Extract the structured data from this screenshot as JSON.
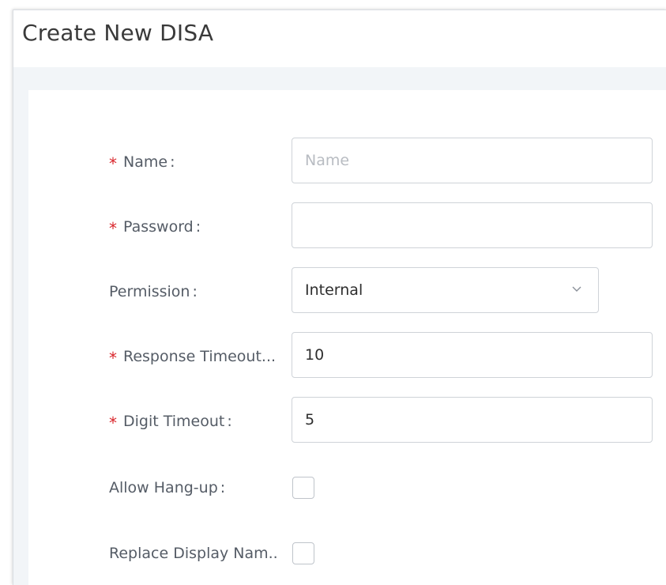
{
  "dialog": {
    "title": "Create New DISA"
  },
  "form": {
    "required_mark": "*",
    "name": {
      "label": "Name",
      "colon": ":",
      "placeholder": "Name",
      "value": ""
    },
    "password": {
      "label": "Password",
      "colon": ":",
      "value": ""
    },
    "permission": {
      "label": "Permission",
      "colon": ":",
      "selected": "Internal"
    },
    "response_timeout": {
      "label": "Response Timeout...",
      "value": "10"
    },
    "digit_timeout": {
      "label": "Digit Timeout",
      "colon": ":",
      "value": "5"
    },
    "allow_hangup": {
      "label": "Allow Hang-up",
      "colon": ":",
      "checked": false
    },
    "replace_display_name": {
      "label": "Replace Display Nam..",
      "checked": false
    }
  },
  "icons": {
    "select_chevron": "chevron-down-icon"
  },
  "colors": {
    "required": "#d9252b",
    "label": "#555c66",
    "border": "#cfd3d8",
    "background": "#f2f5f8"
  }
}
